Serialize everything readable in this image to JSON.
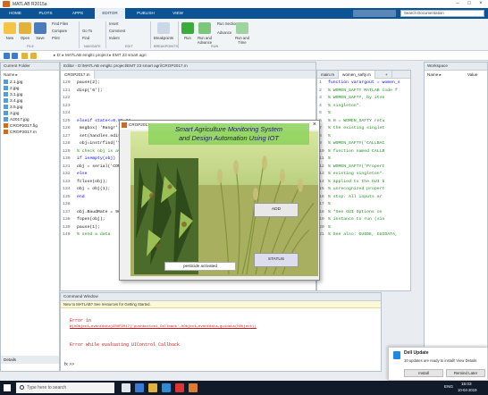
{
  "window": {
    "title": "MATLAB R2015a"
  },
  "ribbon_tabs": [
    "HOME",
    "PLOTS",
    "APPS",
    "EDITOR",
    "PUBLISH",
    "VIEW"
  ],
  "active_tab": "EDITOR",
  "search_placeholder": "Search Documentation",
  "ribbon": {
    "new": "New",
    "open": "Open",
    "save": "Save",
    "find_files": "Find Files",
    "compare": "Compare",
    "print": "Print",
    "go_to": "Go To",
    "find": "Find",
    "insert": "Insert",
    "comment": "Comment",
    "indent": "Indent",
    "breakpoints": "Breakpoints",
    "run": "Run",
    "run_and_advance": "Run and Advance",
    "run_section": "Run Section",
    "advance": "Advance",
    "run_and_time": "Run and Time",
    "groups": [
      "FILE",
      "NAVIGATE",
      "EDIT",
      "BREAKPOINTS",
      "RUN"
    ]
  },
  "address_path": "▸ D: ▸ MATLAB emgltc project ▸ EMT 23 smart agri",
  "current_folder": {
    "title": "Current Folder",
    "header": "Name ▸",
    "items": [
      "2.1.jpg",
      "2.jpg",
      "3.1.jpg",
      "3.4.jpg",
      "3.5.jpg",
      "3.jpg",
      "A2017.jpg",
      "CROP2017.fig",
      "CROP2017.m"
    ]
  },
  "editor": {
    "title": "Editor - D:\\MATLAB emgltc project\\EMT 23 smart agri\\CROP2017.m",
    "tab": "CROP2017.m",
    "lines": [
      {
        "n": "120",
        "t": "pause(2);"
      },
      {
        "n": "121",
        "t": "disp('6');"
      },
      {
        "n": "122",
        "t": ""
      },
      {
        "n": "123",
        "t": ""
      },
      {
        "n": "124",
        "t": ""
      },
      {
        "n": "125",
        "t": "elseif state<=0.95 &&"
      },
      {
        "n": "126",
        "t": "    msgbox( 'Rangr'"
      },
      {
        "n": "127",
        "t": "    set(handles.edit1,"
      },
      {
        "n": "128",
        "t": "        obj=instrfind('T"
      },
      {
        "n": "129",
        "t": "% check obj is availab"
      },
      {
        "n": "130",
        "t": "if isempty(obj)"
      },
      {
        "n": "131",
        "t": "obj = serial('COM13'"
      },
      {
        "n": "132",
        "t": "else"
      },
      {
        "n": "133",
        "t": "fclose(obj);"
      },
      {
        "n": "134",
        "t": "obj = obj(1);"
      },
      {
        "n": "135",
        "t": "end"
      },
      {
        "n": "136",
        "t": ""
      },
      {
        "n": "137",
        "t": "obj.BaudRate = 9600;"
      },
      {
        "n": "138",
        "t": "fopen(obj);"
      },
      {
        "n": "139",
        "t": "pause(1);"
      },
      {
        "n": "140",
        "t": "% send a data"
      }
    ]
  },
  "editor2": {
    "tabs": [
      "main.m",
      "women_safty.m",
      "+"
    ],
    "lines": [
      {
        "n": "1",
        "t": "function varargout = women_s"
      },
      {
        "n": "2",
        "t": "% WOMEN_SAFTY MATLAB code f"
      },
      {
        "n": "3",
        "t": "%      WOMEN_SAFTY, by itse"
      },
      {
        "n": "4",
        "t": "%      singleton*."
      },
      {
        "n": "5",
        "t": "%"
      },
      {
        "n": "6",
        "t": "%      H = WOMEN_SAFTY retu"
      },
      {
        "n": "7",
        "t": "%      the existing singlet"
      },
      {
        "n": "8",
        "t": "%"
      },
      {
        "n": "9",
        "t": "%      WOMEN_SAFTY('CALLBAC"
      },
      {
        "n": "10",
        "t": "%      function named CALLB"
      },
      {
        "n": "11",
        "t": "%"
      },
      {
        "n": "12",
        "t": "%      WOMEN_SAFTY('Propert"
      },
      {
        "n": "13",
        "t": "%      existing singleton*."
      },
      {
        "n": "14",
        "t": "%      applied to the GUI b"
      },
      {
        "n": "15",
        "t": "%      unrecognized propert"
      },
      {
        "n": "16",
        "t": "%      stop.  All inputs ar"
      },
      {
        "n": "17",
        "t": "%"
      },
      {
        "n": "18",
        "t": "%      *See GUI Options on"
      },
      {
        "n": "19",
        "t": "%      instance to run (sin"
      },
      {
        "n": "20",
        "t": "%"
      },
      {
        "n": "21",
        "t": "% See also: GUIDE, GUIDATA,"
      }
    ]
  },
  "workspace": {
    "title": "Workspace",
    "col_name": "Name ▸",
    "col_value": "Value"
  },
  "dialog": {
    "title": "CROP2017",
    "banner_line1": "Smart Agriculture Monitoring System",
    "banner_line2": "and Design Automation Using IOT",
    "add_label": "ADD",
    "status_label": "STATUS",
    "pesticide_text": "pesticide activated"
  },
  "command_window": {
    "title": "Command Window",
    "notice": "New to MATLAB? See resources for Getting Started.",
    "err1": "Error in",
    "err2": "@(hObject,eventdata)CROP2017('pushbutton1_Callback',hObject,eventdata,guidata(hObject))",
    "err3": "Error while evaluating UIControl Callback",
    "prompt": "fx >>"
  },
  "details": "Details",
  "notification": {
    "title": "Dell Update",
    "body": "10 updates are ready to install! View Details",
    "install": "Install",
    "remind": "Remind Later"
  },
  "taskbar": {
    "search": "Type here to search",
    "lang": "ENG",
    "time": "15:03",
    "date": "10-04-2019"
  },
  "colors": {
    "ribbon": "#0b5394",
    "taskbar": "#101a28",
    "error": "#cc1a1a",
    "comment": "#228b22"
  }
}
